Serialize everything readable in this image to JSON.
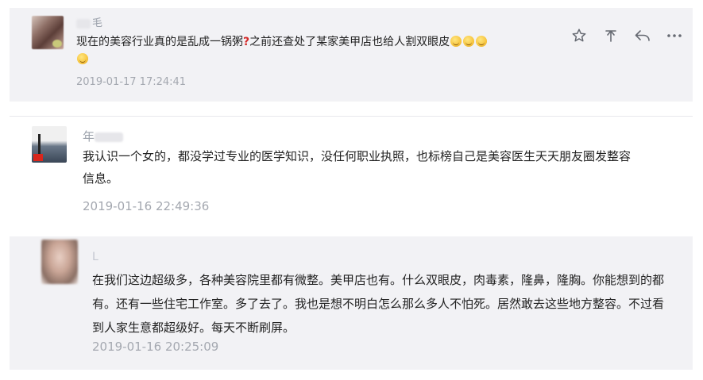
{
  "comments": [
    {
      "name": "毛",
      "text": "现在的美容行业真的是乱成一锅粥",
      "text_after_q": "之前还查处了某家美甲店也给人割双眼皮",
      "timestamp": "2019-01-17 17:24:41",
      "actions": [
        "star-icon",
        "thumbs-down-icon",
        "reply-icon",
        "more-icon"
      ]
    },
    {
      "name": "年",
      "text": "我认识一个女的，都没学过专业的医学知识，没任何职业执照，也标榜自己是美容医生天天朋友圈发整容信息。",
      "timestamp": "2019-01-16 22:49:36"
    },
    {
      "name": "L",
      "text": "在我们这边超级多，各种美容院里都有微整。美甲店也有。什么双眼皮，肉毒素，隆鼻，隆胸。你能想到的都有。还有一些住宅工作室。多了去了。我也是想不明白怎么那么多人不怕死。居然敢去这些地方整容。不过看到人家生意都超级好。每天不断刷屏。",
      "timestamp": "2019-01-16 20:25:09"
    }
  ],
  "colors": {
    "highlight_bg": "#f2f2f5",
    "text": "#222222",
    "meta": "#a4a8b0"
  }
}
